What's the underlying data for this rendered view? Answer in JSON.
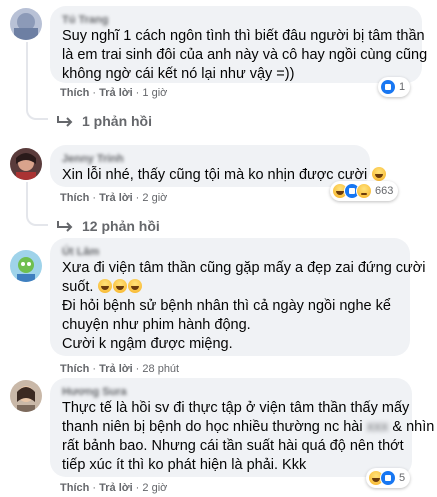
{
  "comments": [
    {
      "author": "Tú Trang",
      "lines": [
        "Suy nghĩ 1 cách ngôn tình thì biết đâu người bị tâm thần",
        "là em trai sinh đôi của anh này và cô hay ngồi cùng cũng",
        "không ngờ cái kết nó lại như vậy =))"
      ],
      "like": "Thích",
      "reply": "Trả lời",
      "time": "1 giờ",
      "reaction_count": "1",
      "reactions": [
        "like-icon"
      ]
    },
    {
      "author": "Jenny Trinh",
      "lines": [
        "Xin lỗi nhé, thấy cũng tội mà ko nhịn được cười"
      ],
      "like": "Thích",
      "reply": "Trả lời",
      "time": "2 giờ",
      "reaction_count": "663",
      "reactions": [
        "haha-icon",
        "like-icon",
        "sad-icon"
      ]
    },
    {
      "author": "Út Lâm",
      "lines": [
        "Xưa đi viện tâm thần cũng gặp mấy a đẹp zai đứng cười",
        "suốt.",
        "Đi hỏi bệnh sử bệnh nhân thì cả ngày ngồi nghe kể",
        "chuyện như phim hành động.",
        "Cười k ngậm được miệng."
      ],
      "like": "Thích",
      "reply": "Trả lời",
      "time": "28 phút"
    },
    {
      "author": "Hương Sura",
      "lines": [
        "Thực tế là hồi sv đi thực tập ở viện tâm thần thấy mấy",
        "thanh niên bị bệnh do học nhiều thường nc hài",
        "rất bảnh bao. Nhưng cái tần suất hài quá độ nên thớt",
        "tiếp xúc ít thì ko phát hiện là phải. Kkk"
      ],
      "line2_tail": "& nhìn",
      "line2_hidden": "xxx",
      "like": "Thích",
      "reply": "Trả lời",
      "time": "2 giờ",
      "reaction_count": "5",
      "reactions": [
        "haha-icon",
        "like-icon"
      ]
    }
  ],
  "reply_threads": [
    {
      "label": "1 phản hồi"
    },
    {
      "label": "12 phản hồi"
    }
  ]
}
